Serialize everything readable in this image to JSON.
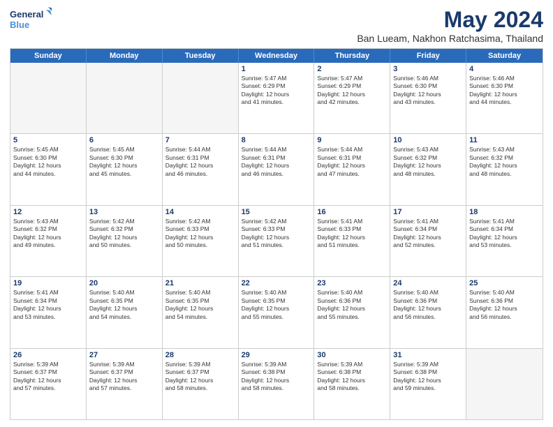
{
  "logo": {
    "line1": "General",
    "line2": "Blue"
  },
  "title": "May 2024",
  "subtitle": "Ban Lueam, Nakhon Ratchasima, Thailand",
  "weekdays": [
    "Sunday",
    "Monday",
    "Tuesday",
    "Wednesday",
    "Thursday",
    "Friday",
    "Saturday"
  ],
  "weeks": [
    [
      {
        "day": "",
        "lines": []
      },
      {
        "day": "",
        "lines": []
      },
      {
        "day": "",
        "lines": []
      },
      {
        "day": "1",
        "lines": [
          "Sunrise: 5:47 AM",
          "Sunset: 6:29 PM",
          "Daylight: 12 hours",
          "and 41 minutes."
        ]
      },
      {
        "day": "2",
        "lines": [
          "Sunrise: 5:47 AM",
          "Sunset: 6:29 PM",
          "Daylight: 12 hours",
          "and 42 minutes."
        ]
      },
      {
        "day": "3",
        "lines": [
          "Sunrise: 5:46 AM",
          "Sunset: 6:30 PM",
          "Daylight: 12 hours",
          "and 43 minutes."
        ]
      },
      {
        "day": "4",
        "lines": [
          "Sunrise: 5:46 AM",
          "Sunset: 6:30 PM",
          "Daylight: 12 hours",
          "and 44 minutes."
        ]
      }
    ],
    [
      {
        "day": "5",
        "lines": [
          "Sunrise: 5:45 AM",
          "Sunset: 6:30 PM",
          "Daylight: 12 hours",
          "and 44 minutes."
        ]
      },
      {
        "day": "6",
        "lines": [
          "Sunrise: 5:45 AM",
          "Sunset: 6:30 PM",
          "Daylight: 12 hours",
          "and 45 minutes."
        ]
      },
      {
        "day": "7",
        "lines": [
          "Sunrise: 5:44 AM",
          "Sunset: 6:31 PM",
          "Daylight: 12 hours",
          "and 46 minutes."
        ]
      },
      {
        "day": "8",
        "lines": [
          "Sunrise: 5:44 AM",
          "Sunset: 6:31 PM",
          "Daylight: 12 hours",
          "and 46 minutes."
        ]
      },
      {
        "day": "9",
        "lines": [
          "Sunrise: 5:44 AM",
          "Sunset: 6:31 PM",
          "Daylight: 12 hours",
          "and 47 minutes."
        ]
      },
      {
        "day": "10",
        "lines": [
          "Sunrise: 5:43 AM",
          "Sunset: 6:32 PM",
          "Daylight: 12 hours",
          "and 48 minutes."
        ]
      },
      {
        "day": "11",
        "lines": [
          "Sunrise: 5:43 AM",
          "Sunset: 6:32 PM",
          "Daylight: 12 hours",
          "and 48 minutes."
        ]
      }
    ],
    [
      {
        "day": "12",
        "lines": [
          "Sunrise: 5:43 AM",
          "Sunset: 6:32 PM",
          "Daylight: 12 hours",
          "and 49 minutes."
        ]
      },
      {
        "day": "13",
        "lines": [
          "Sunrise: 5:42 AM",
          "Sunset: 6:32 PM",
          "Daylight: 12 hours",
          "and 50 minutes."
        ]
      },
      {
        "day": "14",
        "lines": [
          "Sunrise: 5:42 AM",
          "Sunset: 6:33 PM",
          "Daylight: 12 hours",
          "and 50 minutes."
        ]
      },
      {
        "day": "15",
        "lines": [
          "Sunrise: 5:42 AM",
          "Sunset: 6:33 PM",
          "Daylight: 12 hours",
          "and 51 minutes."
        ]
      },
      {
        "day": "16",
        "lines": [
          "Sunrise: 5:41 AM",
          "Sunset: 6:33 PM",
          "Daylight: 12 hours",
          "and 51 minutes."
        ]
      },
      {
        "day": "17",
        "lines": [
          "Sunrise: 5:41 AM",
          "Sunset: 6:34 PM",
          "Daylight: 12 hours",
          "and 52 minutes."
        ]
      },
      {
        "day": "18",
        "lines": [
          "Sunrise: 5:41 AM",
          "Sunset: 6:34 PM",
          "Daylight: 12 hours",
          "and 53 minutes."
        ]
      }
    ],
    [
      {
        "day": "19",
        "lines": [
          "Sunrise: 5:41 AM",
          "Sunset: 6:34 PM",
          "Daylight: 12 hours",
          "and 53 minutes."
        ]
      },
      {
        "day": "20",
        "lines": [
          "Sunrise: 5:40 AM",
          "Sunset: 6:35 PM",
          "Daylight: 12 hours",
          "and 54 minutes."
        ]
      },
      {
        "day": "21",
        "lines": [
          "Sunrise: 5:40 AM",
          "Sunset: 6:35 PM",
          "Daylight: 12 hours",
          "and 54 minutes."
        ]
      },
      {
        "day": "22",
        "lines": [
          "Sunrise: 5:40 AM",
          "Sunset: 6:35 PM",
          "Daylight: 12 hours",
          "and 55 minutes."
        ]
      },
      {
        "day": "23",
        "lines": [
          "Sunrise: 5:40 AM",
          "Sunset: 6:36 PM",
          "Daylight: 12 hours",
          "and 55 minutes."
        ]
      },
      {
        "day": "24",
        "lines": [
          "Sunrise: 5:40 AM",
          "Sunset: 6:36 PM",
          "Daylight: 12 hours",
          "and 56 minutes."
        ]
      },
      {
        "day": "25",
        "lines": [
          "Sunrise: 5:40 AM",
          "Sunset: 6:36 PM",
          "Daylight: 12 hours",
          "and 56 minutes."
        ]
      }
    ],
    [
      {
        "day": "26",
        "lines": [
          "Sunrise: 5:39 AM",
          "Sunset: 6:37 PM",
          "Daylight: 12 hours",
          "and 57 minutes."
        ]
      },
      {
        "day": "27",
        "lines": [
          "Sunrise: 5:39 AM",
          "Sunset: 6:37 PM",
          "Daylight: 12 hours",
          "and 57 minutes."
        ]
      },
      {
        "day": "28",
        "lines": [
          "Sunrise: 5:39 AM",
          "Sunset: 6:37 PM",
          "Daylight: 12 hours",
          "and 58 minutes."
        ]
      },
      {
        "day": "29",
        "lines": [
          "Sunrise: 5:39 AM",
          "Sunset: 6:38 PM",
          "Daylight: 12 hours",
          "and 58 minutes."
        ]
      },
      {
        "day": "30",
        "lines": [
          "Sunrise: 5:39 AM",
          "Sunset: 6:38 PM",
          "Daylight: 12 hours",
          "and 58 minutes."
        ]
      },
      {
        "day": "31",
        "lines": [
          "Sunrise: 5:39 AM",
          "Sunset: 6:38 PM",
          "Daylight: 12 hours",
          "and 59 minutes."
        ]
      },
      {
        "day": "",
        "lines": []
      }
    ]
  ]
}
